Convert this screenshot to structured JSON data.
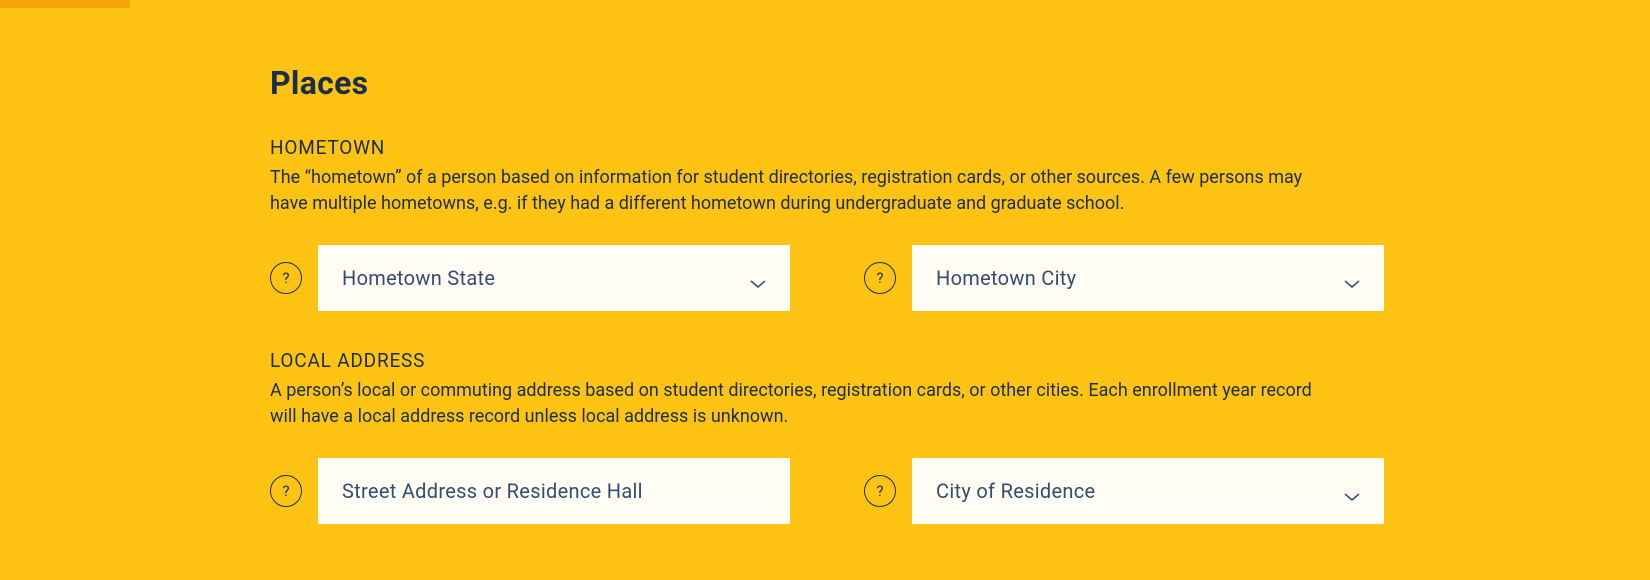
{
  "section": {
    "title": "Places"
  },
  "hometown": {
    "label": "HOMETOWN",
    "description": "The “hometown” of a person based on information for student directories, registration cards, or other sources. A few persons may have multiple hometowns, e.g. if they had a different hometown during undergraduate and graduate school.",
    "help_icon": "?",
    "state": {
      "label": "Hometown State"
    },
    "city": {
      "label": "Hometown City"
    }
  },
  "local_address": {
    "label": "LOCAL ADDRESS",
    "description": "A person’s local or commuting address based on student directories, registration cards, or other cities. Each enrollment year record will have a local address record unless local address is unknown.",
    "help_icon": "?",
    "street": {
      "placeholder": "Street Address or Residence Hall"
    },
    "city": {
      "label": "City of Residence"
    }
  }
}
